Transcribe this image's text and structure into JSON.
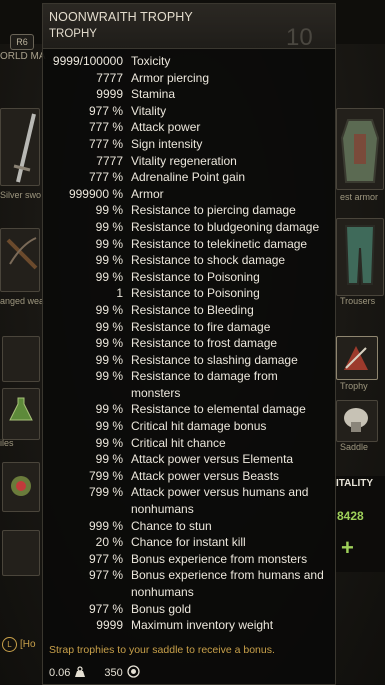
{
  "background": {
    "tab_badge": "R6",
    "world_map_label": "ORLD MA",
    "slot_labels": {
      "silver_sword": "Silver swo",
      "ranged": "anged wea",
      "armor": "est armor",
      "trousers": "Trousers",
      "trophy": "Trophy",
      "saddle": "Saddle",
      "bombs": "iles"
    },
    "vitality_title": "ITALITY",
    "vitality_value": "8428",
    "vitality_plus": "+",
    "left_hint_key": "L",
    "left_hint_text": "[Ho"
  },
  "tooltip": {
    "item_name": "NOONWRAITH TROPHY",
    "item_type": "TROPHY",
    "level": "10",
    "stats": [
      {
        "value": "9999/100000",
        "name": "Toxicity"
      },
      {
        "value": "7777",
        "name": "Armor piercing"
      },
      {
        "value": "9999",
        "name": "Stamina"
      },
      {
        "value": "977 %",
        "name": "Vitality"
      },
      {
        "value": "777 %",
        "name": "Attack power"
      },
      {
        "value": "777 %",
        "name": "Sign intensity"
      },
      {
        "value": "7777",
        "name": "Vitality regeneration"
      },
      {
        "value": "777 %",
        "name": "Adrenaline Point gain"
      },
      {
        "value": "999900 %",
        "name": "Armor"
      },
      {
        "value": "99 %",
        "name": "Resistance to piercing damage"
      },
      {
        "value": "99 %",
        "name": "Resistance to bludgeoning damage"
      },
      {
        "value": "99 %",
        "name": "Resistance to telekinetic damage"
      },
      {
        "value": "99 %",
        "name": "Resistance to shock damage"
      },
      {
        "value": "99 %",
        "name": "Resistance to Poisoning"
      },
      {
        "value": "1",
        "name": "Resistance to Poisoning"
      },
      {
        "value": "99 %",
        "name": "Resistance to Bleeding"
      },
      {
        "value": "99 %",
        "name": "Resistance to fire damage"
      },
      {
        "value": "99 %",
        "name": "Resistance to frost damage"
      },
      {
        "value": "99 %",
        "name": "Resistance to slashing damage"
      },
      {
        "value": "99 %",
        "name": "Resistance to damage from monsters"
      },
      {
        "value": "99 %",
        "name": "Resistance to elemental damage"
      },
      {
        "value": "99 %",
        "name": "Critical hit damage bonus"
      },
      {
        "value": "99 %",
        "name": "Critical hit chance"
      },
      {
        "value": "99 %",
        "name": "Attack power versus Elementa"
      },
      {
        "value": "799 %",
        "name": "Attack power versus Beasts"
      },
      {
        "value": "799 %",
        "name": "Attack power versus humans and nonhumans"
      },
      {
        "value": "999 %",
        "name": "Chance to stun"
      },
      {
        "value": "20 %",
        "name": "Chance for instant kill"
      },
      {
        "value": "977 %",
        "name": "Bonus experience from monsters"
      },
      {
        "value": "977 %",
        "name": "Bonus experience from humans and nonhumans"
      },
      {
        "value": "977 %",
        "name": "Bonus gold"
      },
      {
        "value": "9999",
        "name": "Maximum inventory weight"
      }
    ],
    "description": "Strap trophies to your saddle to receive a bonus.",
    "weight": "0.06",
    "price": "350",
    "weight_icon": "weight-icon",
    "price_icon": "coins-icon"
  }
}
